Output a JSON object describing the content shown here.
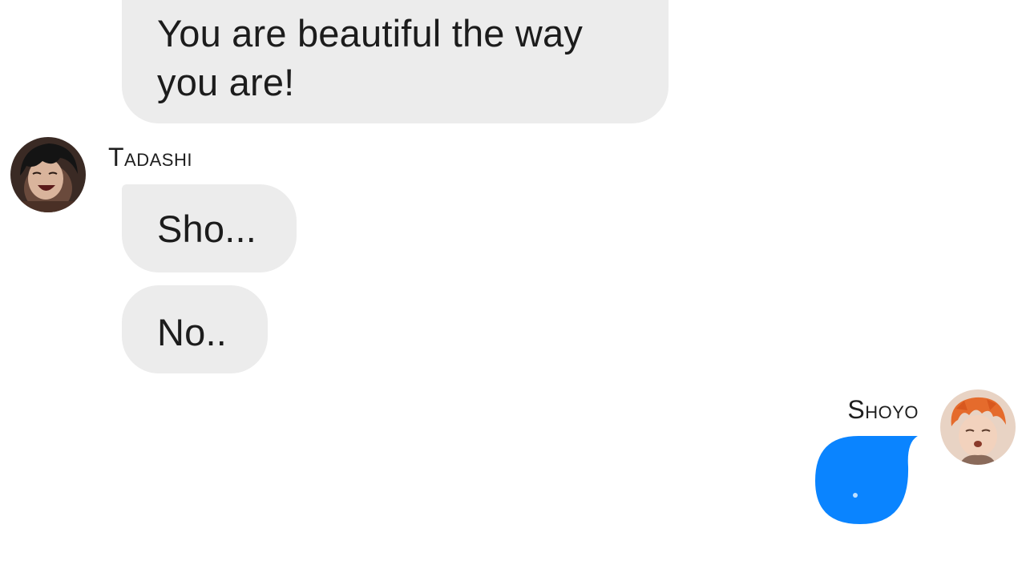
{
  "conversation": {
    "incoming": {
      "previous_message": {
        "lines": [
          "You are beautiful the way",
          "you are!"
        ]
      },
      "sender_name": "Tadashi",
      "messages": [
        "Sho...",
        "No.."
      ]
    },
    "outgoing": {
      "sender_name": "Shoyo",
      "typing_indicator": "."
    }
  },
  "colors": {
    "incoming_bubble": "#ececec",
    "outgoing_bubble": "#0a84ff",
    "background": "#ffffff"
  },
  "icons": {
    "tadashi_avatar": "avatar-dark-hair-character",
    "shoyo_avatar": "avatar-orange-hair-character"
  }
}
